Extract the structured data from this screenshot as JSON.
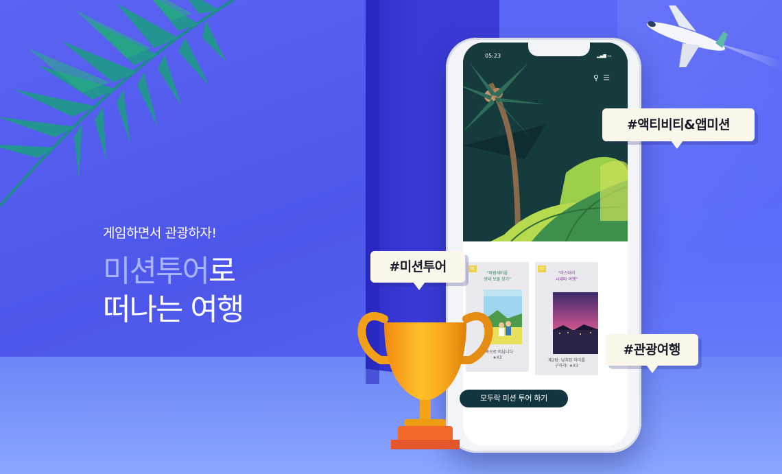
{
  "hero": {
    "subtitle": "게임하면서 관광하자!",
    "title_highlight": "미션투어",
    "title_rest_1": "로",
    "title_line_2": "떠나는 여행"
  },
  "phone": {
    "status_time": "05:23",
    "status_right": "▂▄▆ ▭",
    "search_icon": "search-icon",
    "menu_icon": "menu-icon",
    "cards": [
      {
        "tag": "01",
        "title_1": "\"바람세마을",
        "title_2": "생태 보물 찾기\"",
        "caption_1": "행복으로 떠납니다",
        "caption_2": "★X3"
      },
      {
        "tag": "02",
        "title_1": "\"미스터리",
        "title_2": "시네마 여행\"",
        "caption_1": "제2탐: 납치된 아이를",
        "caption_2": "구하라!  ★X3"
      }
    ],
    "cta_label": "모두락 미션 투어 하기"
  },
  "bubbles": {
    "activity": "#액티비티&앱미션",
    "mission": "#미션투어",
    "tour": "#관광여행"
  },
  "colors": {
    "background": "#5158ef",
    "highlight_text": "#a7b3ff",
    "cta": "#12363f",
    "bubble": "#fbf7ea",
    "trophy": "#f3a316"
  }
}
